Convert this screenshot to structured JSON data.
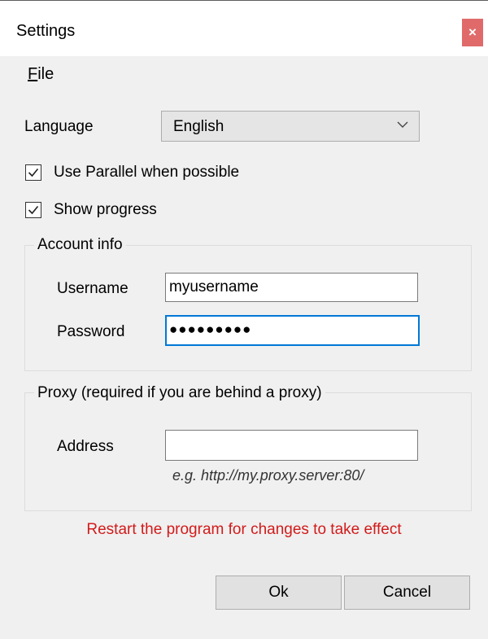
{
  "window": {
    "title": "Settings",
    "close_glyph": "×"
  },
  "menu": {
    "file_accel": "F",
    "file_rest": "ile"
  },
  "language": {
    "label": "Language",
    "selected": "English"
  },
  "options": {
    "parallel": {
      "label": "Use Parallel when possible",
      "checked": true
    },
    "progress": {
      "label": "Show progress",
      "checked": true
    }
  },
  "account": {
    "legend": "Account info",
    "username_label": "Username",
    "username_value": "myusername",
    "password_label": "Password",
    "password_value": "●●●●●●●●●"
  },
  "proxy": {
    "legend": "Proxy (required if you are behind a proxy)",
    "address_label": "Address",
    "address_value": "",
    "hint": "e.g. http://my.proxy.server:80/"
  },
  "notice": "Restart the program for changes to take effect",
  "buttons": {
    "ok": "Ok",
    "cancel": "Cancel"
  },
  "colors": {
    "close_button": "#e06a6a",
    "notice_text": "#d21b1b",
    "focus_border": "#0078d7"
  }
}
